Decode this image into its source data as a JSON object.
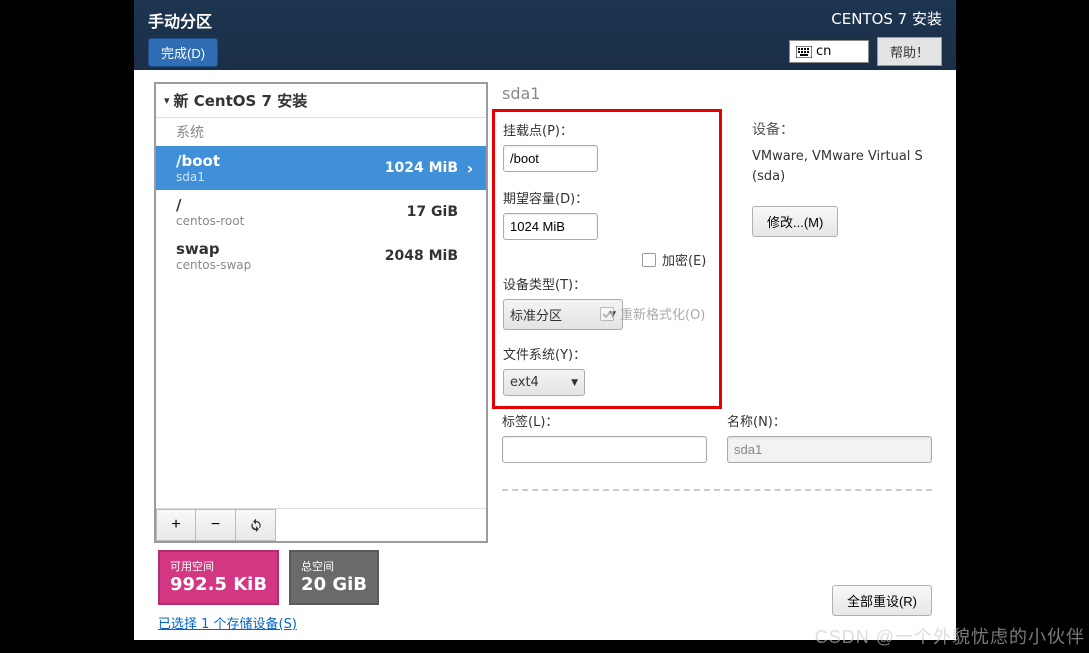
{
  "header": {
    "title": "手动分区",
    "done": "完成(D)",
    "product": "CENTOS 7 安装",
    "keyboard": "cn",
    "help": "帮助！"
  },
  "tree": {
    "root": "新 CentOS 7 安装",
    "section": "系统",
    "partitions": [
      {
        "mount": "/boot",
        "device": "sda1",
        "size": "1024 MiB",
        "selected": true
      },
      {
        "mount": "/",
        "device": "centos-root",
        "size": "17 GiB",
        "selected": false
      },
      {
        "mount": "swap",
        "device": "centos-swap",
        "size": "2048 MiB",
        "selected": false
      }
    ]
  },
  "detail": {
    "title": "sda1",
    "mount_label": "挂载点(P)：",
    "mount_value": "/boot",
    "desired_label": "期望容量(D)：",
    "desired_value": "1024 MiB",
    "devtype_label": "设备类型(T)：",
    "devtype_value": "标准分区",
    "encrypt_label": "加密(E)",
    "fs_label": "文件系统(Y)：",
    "fs_value": "ext4",
    "reformat_label": "重新格式化(O)",
    "tag_label": "标签(L)：",
    "tag_value": "",
    "name_label": "名称(N)：",
    "name_value": "sda1",
    "device_heading": "设备：",
    "device_text": "VMware, VMware Virtual S (sda)",
    "modify": "修改...(M)"
  },
  "footer": {
    "free_label": "可用空间",
    "free_value": "992.5 KiB",
    "total_label": "总空间",
    "total_value": "20 GiB",
    "storage_link": "已选择 1 个存储设备(S)",
    "reset": "全部重设(R)"
  },
  "watermark": "CSDN @一个外貌忧虑的小伙伴"
}
